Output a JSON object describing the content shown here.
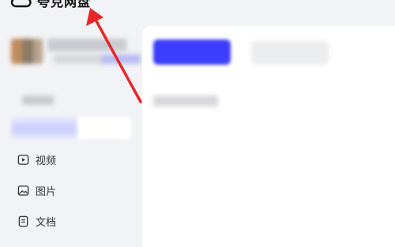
{
  "brand": {
    "name": "夸克网盘"
  },
  "sidebar": {
    "user": {
      "name": "",
      "meta": ""
    },
    "section_label": "",
    "active_item": {
      "label": ""
    },
    "items": [
      {
        "label": "视频",
        "icon": "video-icon"
      },
      {
        "label": "图片",
        "icon": "image-icon"
      },
      {
        "label": "文档",
        "icon": "document-icon"
      }
    ]
  },
  "main": {
    "toolbar": {
      "primary_label": "",
      "secondary_label": ""
    },
    "path_text": ""
  },
  "colors": {
    "accent": "#3b3dff",
    "annotation": "#e8262a",
    "background": "#f2f3f6"
  }
}
